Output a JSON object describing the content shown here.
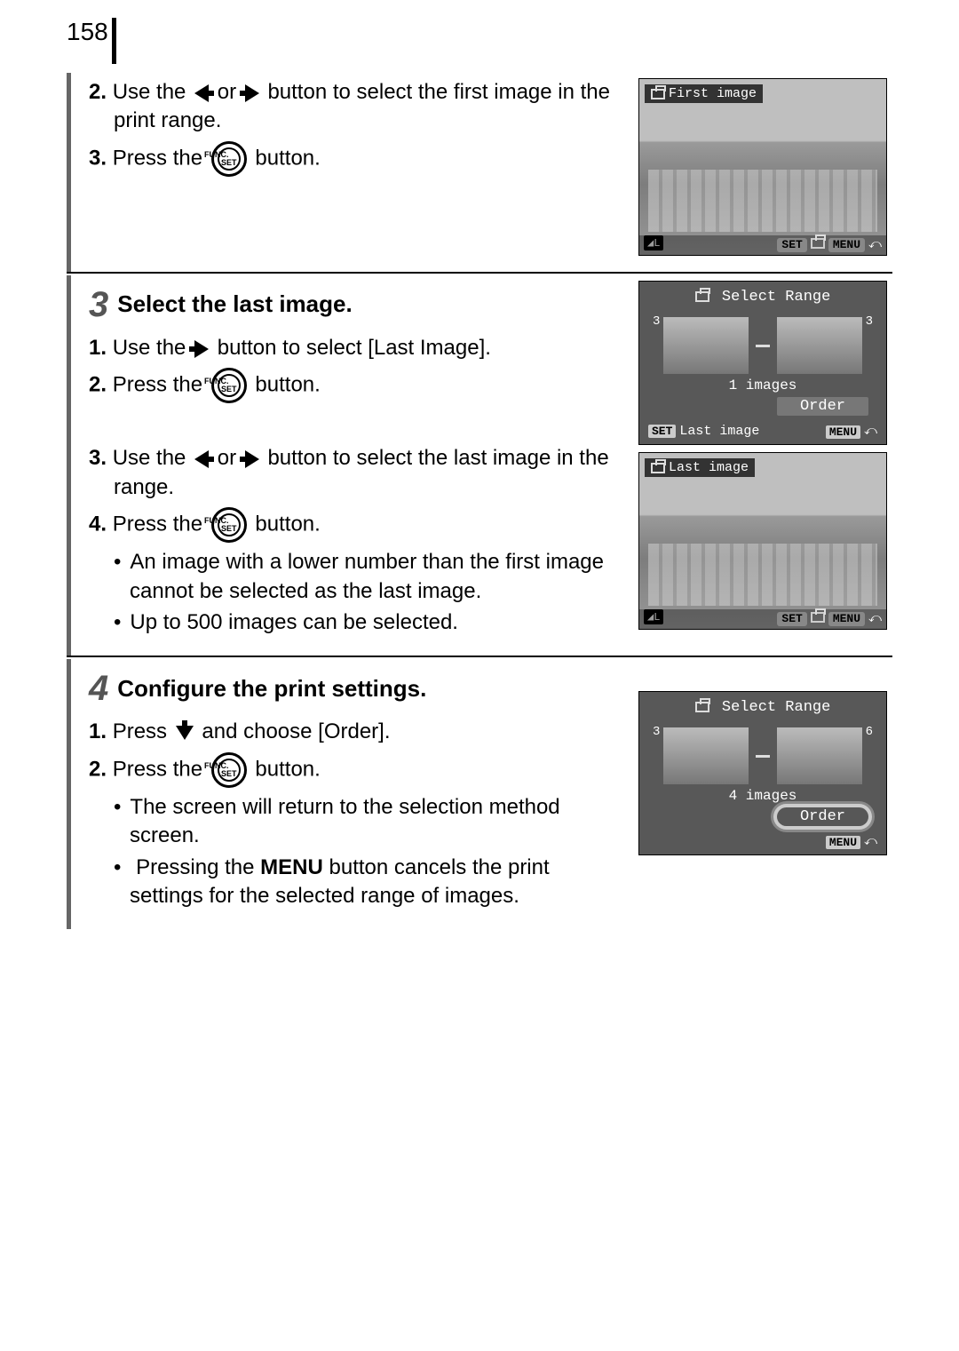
{
  "page_number": "158",
  "section2": {
    "step2_text_a": "Use the",
    "step2_text_b": "or",
    "step2_text_c": "button to select the first image in the print range.",
    "step3_text_a": "Press the",
    "step3_text_c": "button.",
    "func_top": "FUNC.",
    "func_bot": "SET"
  },
  "screen1": {
    "title": "First image",
    "bl_badge": "◢L",
    "set": "SET",
    "menu": "MENU"
  },
  "section3": {
    "number": "3",
    "title": "Select the last image.",
    "step1_a": "Use the",
    "step1_b": "button to select [Last Image].",
    "step2_a": "Press the",
    "step2_b": "button.",
    "step3_a": "Use the",
    "step3_b": "or",
    "step3_c": "button to select the last image in the range.",
    "step4_a": "Press the",
    "step4_b": "button.",
    "bullet1": "An image with a lower number than the first image cannot be selected as the last image.",
    "bullet2": "Up to 500 images can be selected."
  },
  "screen2": {
    "title": "Select Range",
    "first_num": "3",
    "last_num": "3",
    "count": "1 images",
    "order": "Order",
    "set": "SET",
    "last_image": "Last image",
    "menu": "MENU"
  },
  "screen3": {
    "title": "Last image",
    "bl_badge": "◢L",
    "set": "SET",
    "menu": "MENU"
  },
  "section4": {
    "number": "4",
    "title": "Configure the print settings.",
    "step1_a": "Press",
    "step1_b": "and choose [Order].",
    "step2_a": "Press the",
    "step2_b": "button.",
    "bullet1": "The screen will return to the selection method screen.",
    "bullet2_a": "Pressing the",
    "bullet2_menu": "MENU",
    "bullet2_b": "button cancels the print settings for the selected range of images."
  },
  "screen4": {
    "title": "Select Range",
    "first_num": "3",
    "last_num": "6",
    "count": "4 images",
    "order": "Order",
    "menu": "MENU"
  }
}
